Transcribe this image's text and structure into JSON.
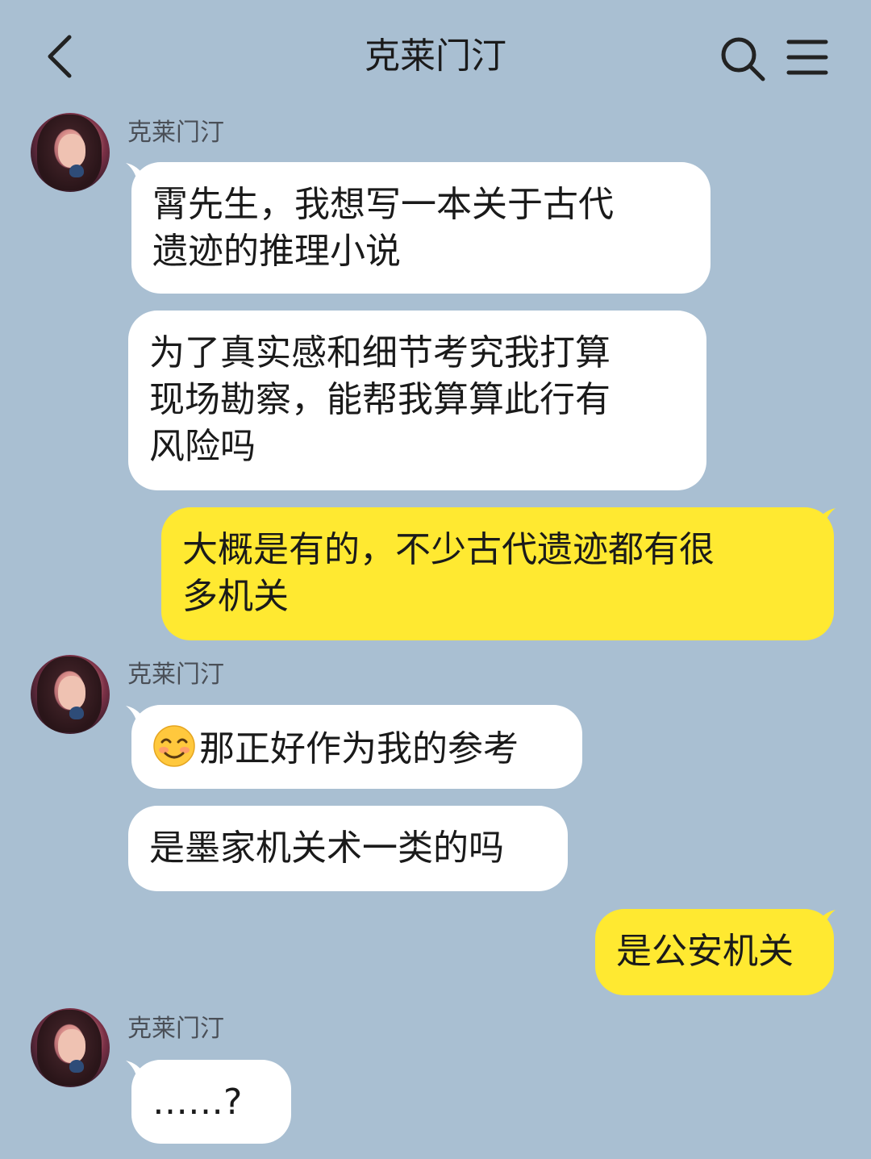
{
  "header": {
    "title": "克莱门汀"
  },
  "messages": [
    {
      "side": "in",
      "sender": "克莱门汀",
      "lines": [
        "霄先生，我想写一本关于古代",
        "遗迹的推理小说"
      ]
    },
    {
      "side": "in",
      "lines": [
        "为了真实感和细节考究我打算",
        "现场勘察，能帮我算算此行有",
        "风险吗"
      ]
    },
    {
      "side": "out",
      "lines": [
        "大概是有的，不少古代遗迹都有很",
        "多机关"
      ]
    },
    {
      "side": "in",
      "sender": "克莱门汀",
      "emoji": "smiling-face-emoji",
      "lines": [
        "那正好作为我的参考"
      ]
    },
    {
      "side": "in",
      "lines": [
        "是墨家机关术一类的吗"
      ]
    },
    {
      "side": "out",
      "lines": [
        "是公安机关"
      ]
    },
    {
      "side": "in",
      "sender": "克莱门汀",
      "lines": [
        "……?"
      ]
    }
  ],
  "colors": {
    "background": "#a9bfd2",
    "incoming_bubble": "#ffffff",
    "outgoing_bubble": "#ffe931"
  },
  "icons": {
    "back": "chevron-left-icon",
    "search": "search-icon",
    "menu": "menu-icon"
  }
}
